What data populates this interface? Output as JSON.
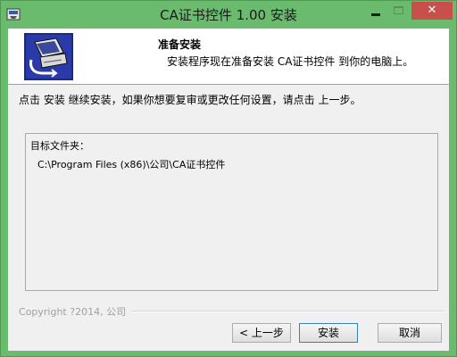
{
  "window": {
    "title": "CA证书控件 1.00 安装",
    "close_glyph": "✕"
  },
  "header": {
    "title": "准备安装",
    "subtitle": "安装程序现在准备安装 CA证书控件 到你的电脑上。"
  },
  "instruction": "点击 安装 继续安装，如果你想要复审或更改任何设置，请点击 上一步。",
  "panel": {
    "label": "目标文件夹：",
    "path": "C:\\Program Files (x86)\\公司\\CA证书控件"
  },
  "footer": {
    "copyright": "Copyright ?2014, 公司"
  },
  "buttons": {
    "back": "< 上一步",
    "install": "安装",
    "cancel": "取消"
  },
  "icons": {
    "app": "installer-app-icon",
    "header": "computer-install-icon"
  },
  "colors": {
    "titlebar": "#6bbb6f",
    "close": "#c7504a",
    "client": "#f0f0f0"
  }
}
